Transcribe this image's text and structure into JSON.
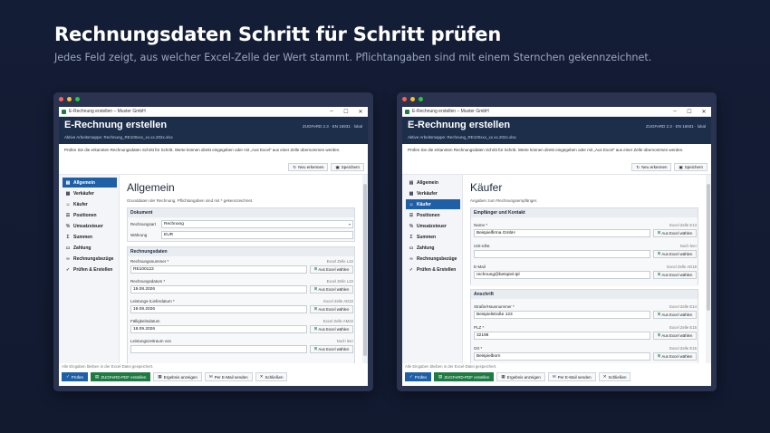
{
  "headline": "Rechnungsdaten Schritt für Schritt prüfen",
  "subline": "Jedes Feld zeigt, aus welcher Excel-Zelle der Wert stammt. Pflichtangaben sind mit einem Sternchen gekennzeichnet.",
  "app": {
    "window_title": "E-Rechnung erstellen – Muster GmbH",
    "header_title": "E-Rechnung erstellen",
    "header_sub": "Aktive Arbeitsmappe: Rechnung_RE100xxx_xx.xx.202x.xlsx",
    "header_right": "ZUGFeRD 2.3 · EN 16931 · lokal",
    "intro": "Prüfen Sie die erkannten Rechnungsdaten Schritt für Schritt. Werte können direkt eingegeben oder mit „Aus Excel“ aus einer Zelle übernommen werden.",
    "btn_new": "Neu erkennen",
    "btn_save": "Speichern",
    "status": "Alle Eingaben bleiben in der Excel-Datei gespeichert.",
    "btn_check": "Prüfen",
    "btn_pdf": "ZUGFeRD-PDF erstellen",
    "btn_result": "Ergebnis anzeigen",
    "btn_mail": "Per E-Mail senden",
    "btn_close": "Schließen",
    "from_excel": "Aus Excel wählen",
    "nav": [
      "Allgemein",
      "Verkäufer",
      "Käufer",
      "Positionen",
      "Umsatzsteuer",
      "Summen",
      "Zahlung",
      "Rechnungsbezüge",
      "Prüfen & Erstellen"
    ]
  },
  "left": {
    "title": "Allgemein",
    "desc": "Grunddaten der Rechnung. Pflichtangaben sind mit * gekennzeichnet.",
    "g1_head": "Dokument",
    "r1_label": "Rechnungsart",
    "r1_value": "Rechnung",
    "r2_label": "Währung",
    "r2_value": "EUR",
    "g2_head": "Rechnungsdaten",
    "fields": [
      {
        "label": "Rechnungsnummer *",
        "source": "Excel Zelle L22",
        "value": "RE100123"
      },
      {
        "label": "Rechnungsdatum *",
        "source": "Excel Zelle L22",
        "value": "19.08.2026"
      },
      {
        "label": "Leistungs-/Lieferdatum *",
        "source": "Excel Zelle AD22",
        "value": "19.08.2026"
      },
      {
        "label": "Fälligkeitsdatum",
        "source": "Excel Zelle AM22",
        "value": "18.09.2026"
      },
      {
        "label": "Leistungszeitraum von",
        "source": "Noch leer",
        "value": ""
      }
    ]
  },
  "right": {
    "title": "Käufer",
    "desc": "Angaben zum Rechnungsempfänger.",
    "g1_head": "Empfänger und Kontakt",
    "g1_fields": [
      {
        "label": "Name *",
        "source": "Excel Zelle E13",
        "value": "Beispielfirma GmbH"
      },
      {
        "label": "USt-IdNr.",
        "source": "Noch leer",
        "value": ""
      },
      {
        "label": "E-Mail",
        "source": "Excel Zelle AD18",
        "value": "rechnung@beispiel.tpl"
      }
    ],
    "g2_head": "Anschrift",
    "g2_fields": [
      {
        "label": "Straße/Hausnummer *",
        "source": "Excel Zelle E14",
        "value": "Beispielstraße 123"
      },
      {
        "label": "PLZ *",
        "source": "Excel Zelle E15",
        "value": "32198"
      },
      {
        "label": "Ort *",
        "source": "Excel Zelle E15",
        "value": "Beispielborn"
      }
    ]
  }
}
